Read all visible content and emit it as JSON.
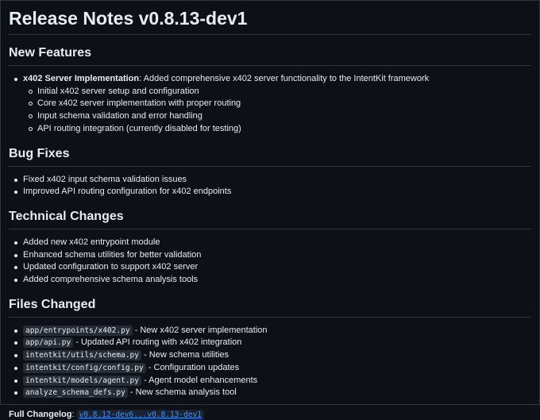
{
  "title": "Release Notes v0.8.13-dev1",
  "new_features": {
    "heading": "New Features",
    "item": {
      "bold": "x402 Server Implementation",
      "rest": ": Added comprehensive x402 server functionality to the IntentKit framework",
      "subitems": [
        "Initial x402 server setup and configuration",
        "Core x402 server implementation with proper routing",
        "Input schema validation and error handling",
        "API routing integration (currently disabled for testing)"
      ]
    }
  },
  "bug_fixes": {
    "heading": "Bug Fixes",
    "items": [
      "Fixed x402 input schema validation issues",
      "Improved API routing configuration for x402 endpoints"
    ]
  },
  "technical_changes": {
    "heading": "Technical Changes",
    "items": [
      "Added new x402 entrypoint module",
      "Enhanced schema utilities for better validation",
      "Updated configuration to support x402 server",
      "Added comprehensive schema analysis tools"
    ]
  },
  "files_changed": {
    "heading": "Files Changed",
    "items": [
      {
        "file": "app/entrypoints/x402.py",
        "desc": " - New x402 server implementation"
      },
      {
        "file": "app/api.py",
        "desc": " - Updated API routing with x402 integration"
      },
      {
        "file": "intentkit/utils/schema.py",
        "desc": " - New schema utilities"
      },
      {
        "file": "intentkit/config/config.py",
        "desc": " - Configuration updates"
      },
      {
        "file": "intentkit/models/agent.py",
        "desc": " - Agent model enhancements"
      },
      {
        "file": "analyze_schema_defs.py",
        "desc": " - New schema analysis tool"
      }
    ]
  },
  "changelog": {
    "label": "Full Changelog",
    "link": "v0.8.12-dev6...v0.8.13-dev1"
  }
}
